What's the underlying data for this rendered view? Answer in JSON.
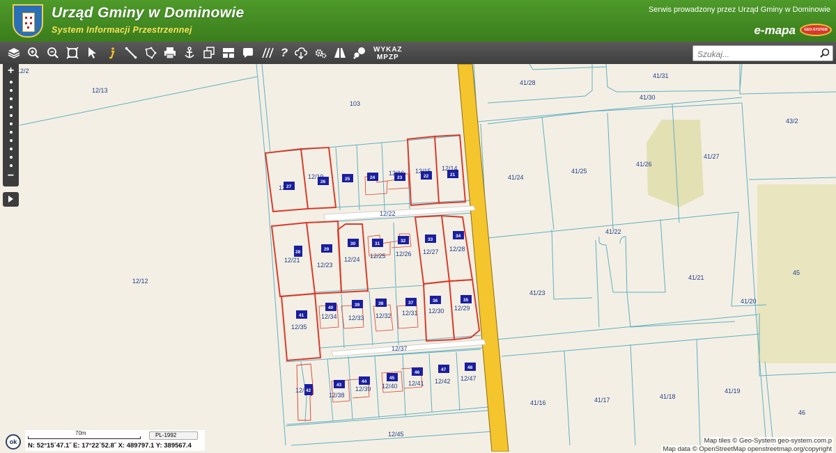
{
  "header": {
    "title": "Urząd Gminy w Dominowie",
    "subtitle": "System Informacji Przestrzennej",
    "operator": "Serwis prowadzony przez Urząd Gminy w Dominowie",
    "brand": "e-mapa",
    "brand_logo_text": "GEO-SYSTEM"
  },
  "toolbar": {
    "tools": [
      "layers-icon",
      "zoom-in-icon",
      "zoom-out-icon",
      "zoom-extent-icon",
      "pointer-icon",
      "info-icon",
      "measure-distance-icon",
      "measure-area-icon",
      "print-icon",
      "anchor-icon",
      "copy-icon",
      "layout-icon",
      "comment-icon",
      "hatch-icon",
      "help-icon",
      "download-icon",
      "settings-icon",
      "road-icon",
      "chat-icon"
    ],
    "wykaz_line1": "WYKAZ",
    "wykaz_line2": "MPZP"
  },
  "search": {
    "placeholder": "Szukaj..."
  },
  "zoom": {
    "plus": "+",
    "minus": "−"
  },
  "scale": {
    "label": "70m",
    "crs": "PL-1992"
  },
  "coords": {
    "text": "N: 52°15´47.1˝  E: 17°22´52.8˝  X: 489797.1  Y: 389567.4"
  },
  "ok_label": "ok",
  "attribution": {
    "tiles": "Map tiles © Geo-System geo-system.com.p",
    "data": "Map data © OpenStreetMap openstreetmap.org/copyright"
  },
  "colors": {
    "header_green": "#3f8420",
    "subtitle_yellow": "#f6e25a",
    "road_yellow": "#f4c52c",
    "parcel_outline": "#5fb0c4",
    "highlight_red": "#d93b2b",
    "building_blue": "#1a1f9e",
    "label_blue": "#1d3f8a"
  },
  "parcels": {
    "p12_2": "12/2",
    "p12_13": "12/13",
    "p103": "103",
    "p12_12": "12/12",
    "p12_19": "12/19",
    "p12_16": "12/16",
    "p12_15": "12/15",
    "p12_14": "12/14",
    "p12_22": "12/22",
    "p12_21": "12/21",
    "p12_23": "12/23",
    "p12_24": "12/24",
    "p12_25": "12/25",
    "p12_26": "12/26",
    "p12_27": "12/27",
    "p12_28": "12/28",
    "p12_34": "12/34",
    "p12_33": "12/33",
    "p12_32": "12/32",
    "p12_31": "12/31",
    "p12_30": "12/30",
    "p12_29": "12/29",
    "p12_35": "12/35",
    "p12_37": "12/37",
    "p12_36": "12/36",
    "p12_38": "12/38",
    "p12_39": "12/39",
    "p12_40": "12/40",
    "p12_41": "12/41",
    "p12_42": "12/42",
    "p12_47": "12/47",
    "p12_45": "12/45",
    "p41_28": "41/28",
    "p41_31": "41/31",
    "p41_30": "41/30",
    "p43_2": "43/2",
    "p41_24": "41/24",
    "p41_25": "41/25",
    "p41_26": "41/26",
    "p41_27": "41/27",
    "p41_22": "41/22",
    "p41_23": "41/23",
    "p41_21": "41/21",
    "p41_20": "41/20",
    "p45": "45",
    "p41_16": "41/16",
    "p41_17": "41/17",
    "p41_18": "41/18",
    "p41_19": "41/19",
    "p46": "46",
    "p12_1": "12/1"
  },
  "buildings": {
    "b27": "27",
    "b26": "26",
    "b25": "25",
    "b24": "24",
    "b23": "23",
    "b22": "22",
    "b21": "21",
    "b28": "28",
    "b29": "29",
    "b30": "30",
    "b31": "31",
    "b32": "32",
    "b33": "33",
    "b34": "34",
    "b41": "41",
    "b40": "40",
    "b39": "39",
    "b38": "38",
    "b37": "37",
    "b36": "36",
    "b35": "35",
    "b42": "42",
    "b43": "43",
    "b44": "44",
    "b45": "45",
    "b46": "46",
    "b47": "47",
    "b48": "48"
  }
}
